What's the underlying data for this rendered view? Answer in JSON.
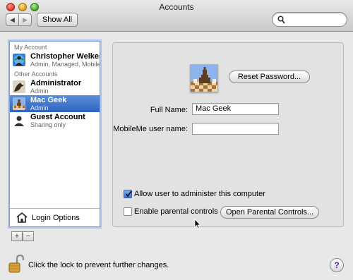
{
  "window": {
    "title": "Accounts"
  },
  "toolbar": {
    "back_glyph": "◀",
    "forward_glyph": "▶",
    "show_all_label": "Show All",
    "search_placeholder": ""
  },
  "sidebar": {
    "my_account_header": "My Account",
    "other_accounts_header": "Other Accounts",
    "accounts": [
      {
        "name": "Christopher Welker",
        "subtitle": "Admin, Managed, Mobile",
        "avatar": "globe-user",
        "selected": false
      },
      {
        "name": "Administrator",
        "subtitle": "Admin",
        "avatar": "eagle",
        "selected": false
      },
      {
        "name": "Mac Geek",
        "subtitle": "Admin",
        "avatar": "chess",
        "selected": true
      },
      {
        "name": "Guest Account",
        "subtitle": "Sharing only",
        "avatar": "silhouette",
        "selected": false
      }
    ],
    "login_options_label": "Login Options",
    "add_label": "+",
    "remove_label": "−"
  },
  "detail": {
    "reset_password_label": "Reset Password...",
    "full_name_label": "Full Name:",
    "full_name_value": "Mac Geek",
    "mobileme_label": "MobileMe user name:",
    "mobileme_value": "",
    "allow_admin_label": "Allow user to administer this computer",
    "allow_admin_checked": true,
    "parental_label": "Enable parental controls",
    "parental_checked": false,
    "open_parental_label": "Open Parental Controls..."
  },
  "footer": {
    "lock_text": "Click the lock to prevent further changes.",
    "help_label": "?"
  },
  "colors": {
    "selection": "#3a6fcb",
    "sidebar_border": "#7fa0d6",
    "checkbox_on": "#3b78d6"
  }
}
